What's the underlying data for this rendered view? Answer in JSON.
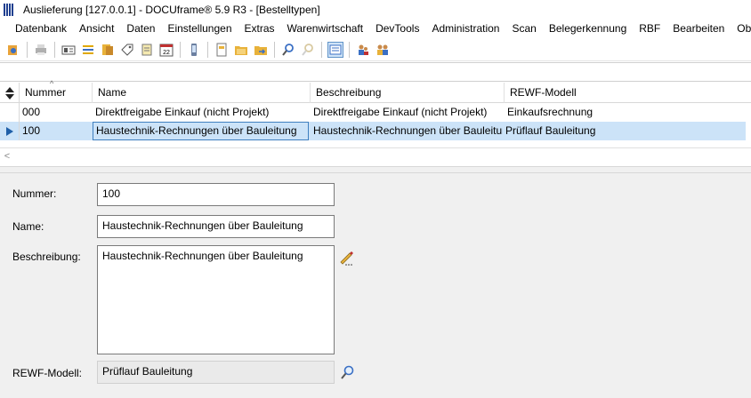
{
  "window": {
    "title": "Auslieferung [127.0.0.1] - DOCUframe® 5.9 R3 - [Bestelltypen]"
  },
  "menu": {
    "items": [
      "Datenbank",
      "Ansicht",
      "Daten",
      "Einstellungen",
      "Extras",
      "Warenwirtschaft",
      "DevTools",
      "Administration",
      "Scan",
      "Belegerkennung",
      "RBF",
      "Bearbeiten",
      "Ob"
    ]
  },
  "toolbar": {
    "icons": [
      "new-record-icon",
      "print-icon",
      "id-card-icon",
      "list-icon",
      "folder-icon",
      "tag-icon",
      "notepad-icon",
      "calendar-icon",
      "phone-icon",
      "document-icon",
      "folder-open-icon",
      "folder-export-icon",
      "search-icon",
      "search-disabled-icon",
      "detail-view-icon",
      "users-icon",
      "user-group-icon"
    ],
    "calendar_day": "22"
  },
  "grid": {
    "columns": [
      "Nummer",
      "Name",
      "Beschreibung",
      "REWF-Modell"
    ],
    "rows": [
      {
        "nummer": "000",
        "name": "Direktfreigabe Einkauf (nicht Projekt)",
        "beschreibung": "Direktfreigabe Einkauf (nicht Projekt)",
        "rewf": "Einkaufsrechnung"
      },
      {
        "nummer": "100",
        "name": "Haustechnik-Rechnungen über Bauleitung",
        "beschreibung": "Haustechnik-Rechnungen über Bauleitung",
        "rewf": "Prüflauf Bauleitung"
      }
    ]
  },
  "form": {
    "nummer_label": "Nummer:",
    "nummer_value": "100",
    "name_label": "Name:",
    "name_value": "Haustechnik-Rechnungen über Bauleitung",
    "beschreibung_label": "Beschreibung:",
    "beschreibung_value": "Haustechnik-Rechnungen über Bauleitung",
    "rewf_label": "REWF-Modell:",
    "rewf_value": "Prüflauf Bauleitung"
  },
  "colors": {
    "selection": "#cce3f8",
    "focus_border": "#3f7fbf",
    "form_bg": "#f0f0f0"
  }
}
